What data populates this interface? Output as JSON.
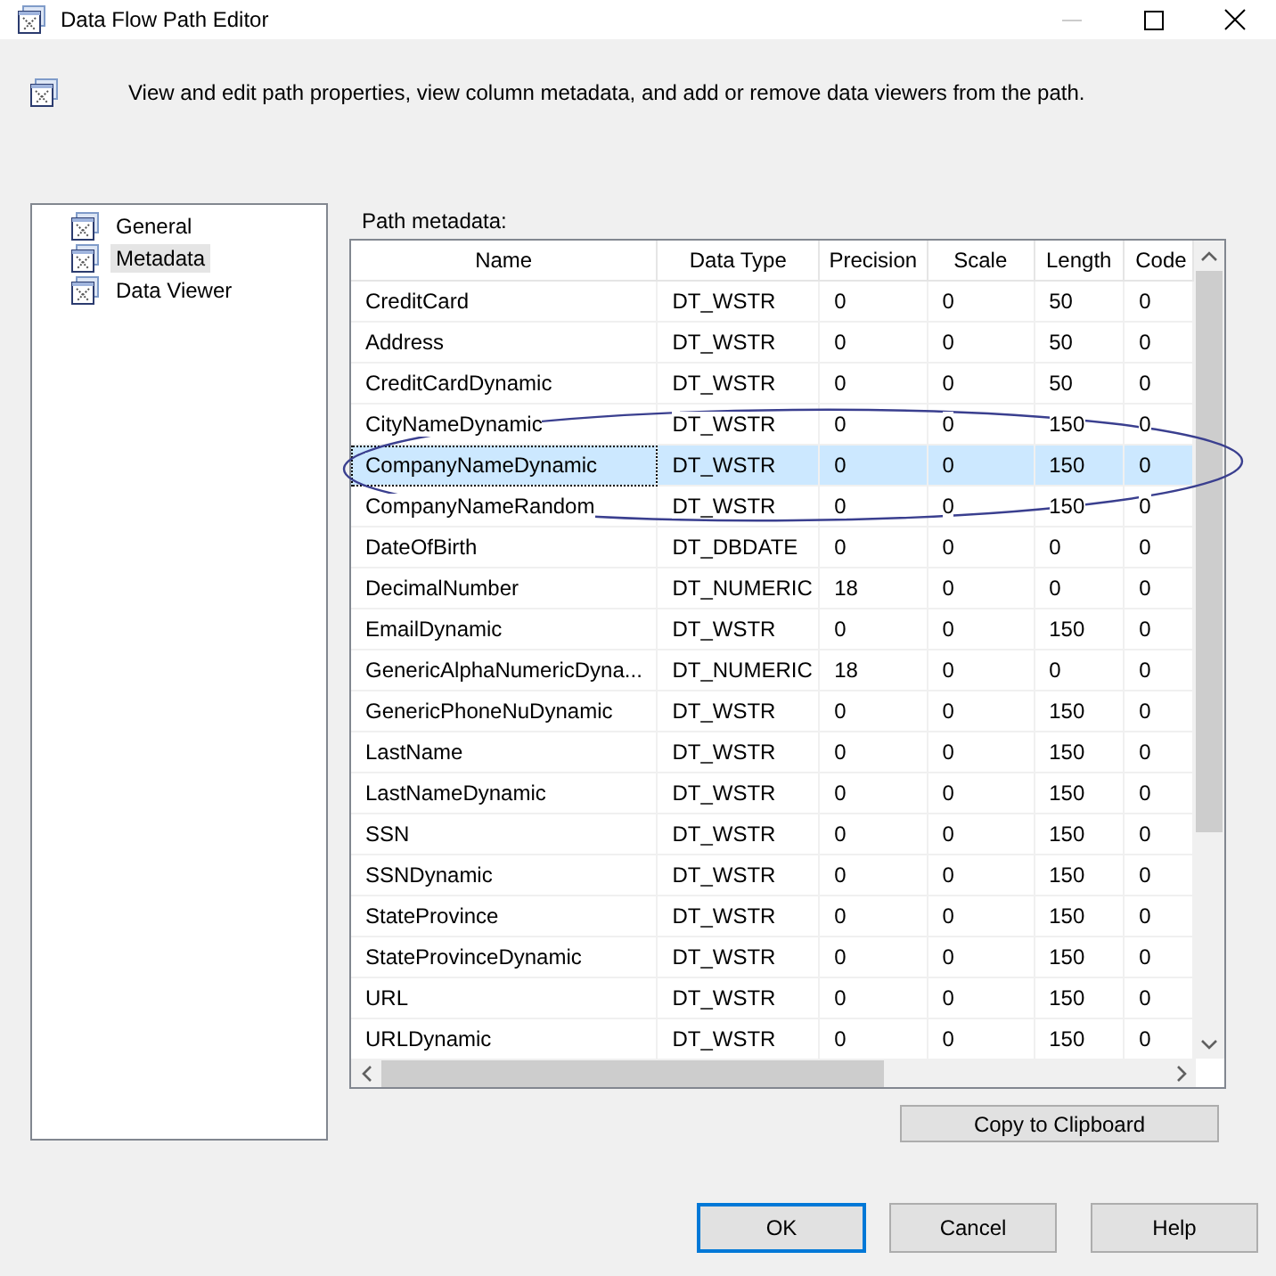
{
  "window": {
    "title": "Data Flow Path Editor"
  },
  "description": "View and edit path properties, view column metadata, and add or remove data viewers from the path.",
  "sidebar": {
    "items": [
      {
        "label": "General",
        "selected": false
      },
      {
        "label": "Metadata",
        "selected": true
      },
      {
        "label": "Data Viewer",
        "selected": false
      }
    ]
  },
  "table": {
    "label": "Path metadata:",
    "columns": [
      "Name",
      "Data Type",
      "Precision",
      "Scale",
      "Length",
      "Code"
    ],
    "rows": [
      {
        "cells": [
          "CreditCard",
          "DT_WSTR",
          "0",
          "0",
          "50",
          "0"
        ],
        "selected": false
      },
      {
        "cells": [
          "Address",
          "DT_WSTR",
          "0",
          "0",
          "50",
          "0"
        ],
        "selected": false
      },
      {
        "cells": [
          "CreditCardDynamic",
          "DT_WSTR",
          "0",
          "0",
          "50",
          "0"
        ],
        "selected": false
      },
      {
        "cells": [
          "CityNameDynamic",
          "DT_WSTR",
          "0",
          "0",
          "150",
          "0"
        ],
        "selected": false
      },
      {
        "cells": [
          "CompanyNameDynamic",
          "DT_WSTR",
          "0",
          "0",
          "150",
          "0"
        ],
        "selected": true
      },
      {
        "cells": [
          "CompanyNameRandom",
          "DT_WSTR",
          "0",
          "0",
          "150",
          "0"
        ],
        "selected": false
      },
      {
        "cells": [
          "DateOfBirth",
          "DT_DBDATE",
          "0",
          "0",
          "0",
          "0"
        ],
        "selected": false
      },
      {
        "cells": [
          "DecimalNumber",
          "DT_NUMERIC",
          "18",
          "0",
          "0",
          "0"
        ],
        "selected": false
      },
      {
        "cells": [
          "EmailDynamic",
          "DT_WSTR",
          "0",
          "0",
          "150",
          "0"
        ],
        "selected": false
      },
      {
        "cells": [
          "GenericAlphaNumericDyna...",
          "DT_NUMERIC",
          "18",
          "0",
          "0",
          "0"
        ],
        "selected": false
      },
      {
        "cells": [
          "GenericPhoneNuDynamic",
          "DT_WSTR",
          "0",
          "0",
          "150",
          "0"
        ],
        "selected": false
      },
      {
        "cells": [
          "LastName",
          "DT_WSTR",
          "0",
          "0",
          "150",
          "0"
        ],
        "selected": false
      },
      {
        "cells": [
          "LastNameDynamic",
          "DT_WSTR",
          "0",
          "0",
          "150",
          "0"
        ],
        "selected": false
      },
      {
        "cells": [
          "SSN",
          "DT_WSTR",
          "0",
          "0",
          "150",
          "0"
        ],
        "selected": false
      },
      {
        "cells": [
          "SSNDynamic",
          "DT_WSTR",
          "0",
          "0",
          "150",
          "0"
        ],
        "selected": false
      },
      {
        "cells": [
          "StateProvince",
          "DT_WSTR",
          "0",
          "0",
          "150",
          "0"
        ],
        "selected": false
      },
      {
        "cells": [
          "StateProvinceDynamic",
          "DT_WSTR",
          "0",
          "0",
          "150",
          "0"
        ],
        "selected": false
      },
      {
        "cells": [
          "URL",
          "DT_WSTR",
          "0",
          "0",
          "150",
          "0"
        ],
        "selected": false
      },
      {
        "cells": [
          "URLDynamic",
          "DT_WSTR",
          "0",
          "0",
          "150",
          "0"
        ],
        "selected": false
      }
    ]
  },
  "annotation": {
    "kind": "ellipse"
  },
  "copy_button": "Copy to Clipboard",
  "buttons": [
    {
      "label": "OK",
      "kind": "default"
    },
    {
      "label": "Cancel",
      "kind": "normal"
    },
    {
      "label": "Help",
      "kind": "normal"
    }
  ]
}
